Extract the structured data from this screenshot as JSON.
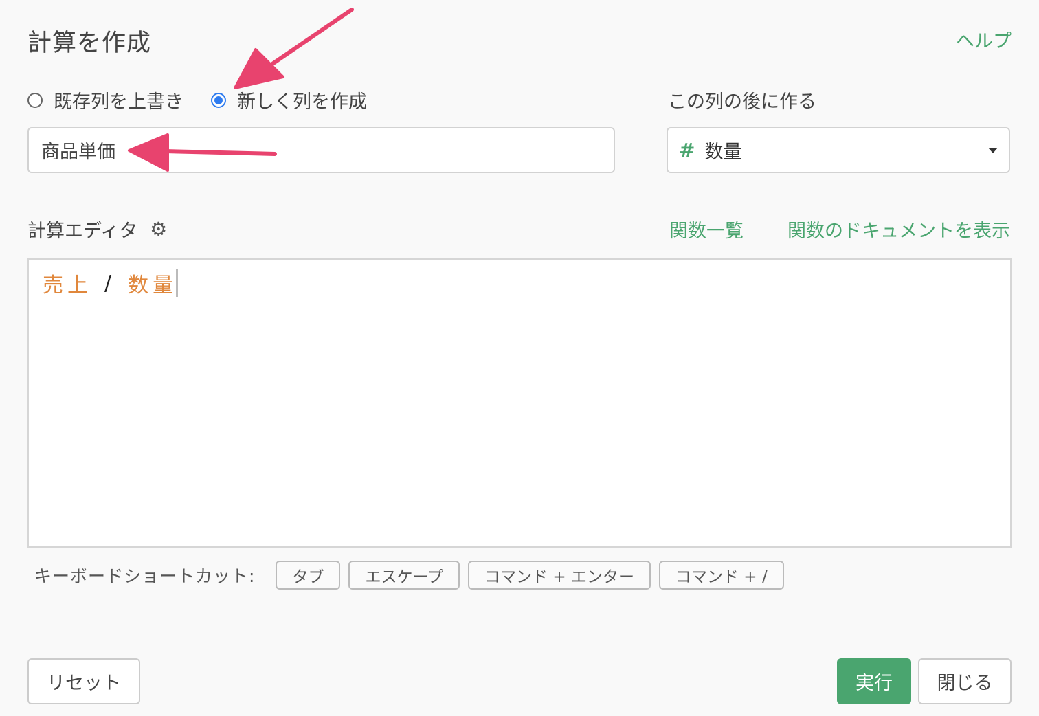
{
  "dialog": {
    "title": "計算を作成",
    "help_link": "ヘルプ"
  },
  "mode": {
    "overwrite_label": "既存列を上書き",
    "create_label": "新しく列を作成",
    "selected": "create"
  },
  "column_name": {
    "value": "商品単価"
  },
  "position": {
    "label": "この列の後に作る",
    "selected_type_icon": "hash-icon",
    "selected_value": "数量"
  },
  "editor": {
    "label": "計算エディタ",
    "settings_icon": "gear-icon",
    "functions_link": "関数一覧",
    "docs_link": "関数のドキュメントを表示",
    "code": {
      "col1": "売上",
      "op": "/",
      "col2": "数量"
    }
  },
  "shortcuts": {
    "label": "キーボードショートカット:",
    "keys": [
      "タブ",
      "エスケープ",
      "コマンド + エンター",
      "コマンド + /"
    ]
  },
  "buttons": {
    "reset": "リセット",
    "run": "実行",
    "close": "閉じる"
  },
  "colors": {
    "accent_green": "#4aa56f",
    "radio_blue": "#2f7cf0",
    "code_column": "#e0873c",
    "annotation_arrow": "#e8436e"
  }
}
